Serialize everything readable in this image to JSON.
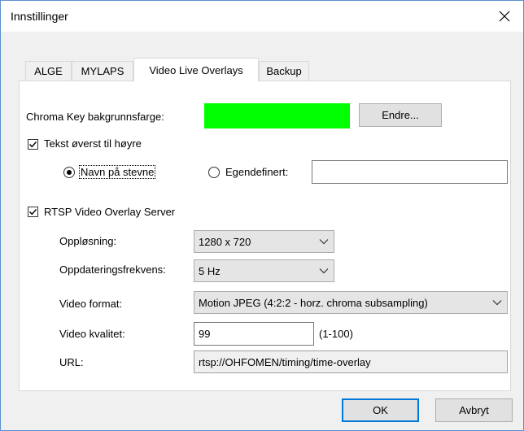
{
  "window": {
    "title": "Innstillinger",
    "close_glyph": "close-icon"
  },
  "tabs": [
    {
      "label": "ALGE",
      "active": false
    },
    {
      "label": "MYLAPS",
      "active": false
    },
    {
      "label": "Video Live Overlays",
      "active": true
    },
    {
      "label": "Backup",
      "active": false
    }
  ],
  "chroma": {
    "label": "Chroma Key bakgrunnsfarge:",
    "color": "#00ff00",
    "change_button": "Endre..."
  },
  "text_top_right": {
    "checkbox_label": "Tekst øverst til høyre",
    "checked": true,
    "option_event_name": "Navn på stevne",
    "option_custom": "Egendefinert:",
    "selected": "event_name",
    "custom_value": ""
  },
  "rtsp": {
    "checkbox_label": "RTSP Video Overlay Server",
    "checked": true,
    "resolution_label": "Oppløsning:",
    "resolution_value": "1280 x 720",
    "update_rate_label": "Oppdateringsfrekvens:",
    "update_rate_value": "5 Hz",
    "video_format_label": "Video format:",
    "video_format_value": "Motion JPEG (4:2:2 - horz. chroma subsampling)",
    "quality_label": "Video kvalitet:",
    "quality_value": "99",
    "quality_range": "(1-100)",
    "url_label": "URL:",
    "url_value": "rtsp://OHFOMEN/timing/time-overlay"
  },
  "buttons": {
    "ok": "OK",
    "cancel": "Avbryt"
  }
}
